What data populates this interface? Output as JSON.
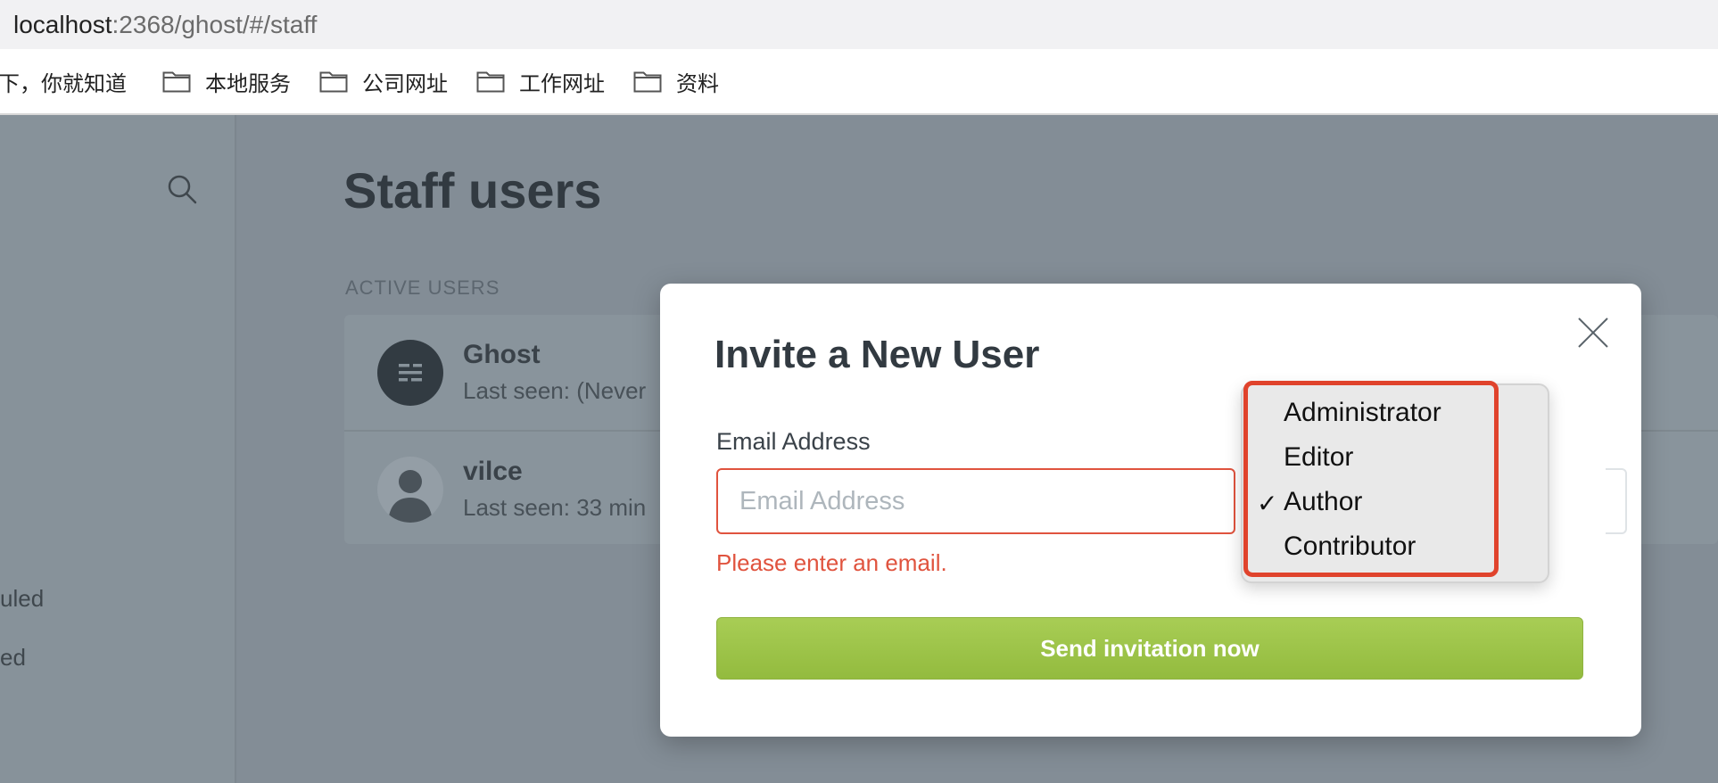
{
  "browser": {
    "url_host": "localhost",
    "url_rest": ":2368/ghost/#/staff",
    "bookmarks": [
      {
        "label": "下，你就知道",
        "icon": "none"
      },
      {
        "label": "本地服务",
        "icon": "folder-icon"
      },
      {
        "label": "公司网址",
        "icon": "folder-icon"
      },
      {
        "label": "工作网址",
        "icon": "folder-icon"
      },
      {
        "label": "资料",
        "icon": "folder-icon"
      }
    ]
  },
  "sidebar": {
    "search_icon": "search-icon",
    "items": [
      "uled",
      "ed"
    ]
  },
  "page": {
    "title": "Staff users",
    "section_label": "ACTIVE USERS",
    "users": [
      {
        "name": "Ghost",
        "last_seen": "Last seen: (Never"
      },
      {
        "name": "vilce",
        "last_seen": "Last seen: 33 min"
      }
    ]
  },
  "modal": {
    "title": "Invite a New User",
    "email_label": "Email Address",
    "email_placeholder": "Email Address",
    "email_value": "",
    "error": "Please enter an email.",
    "send_label": "Send invitation now",
    "role_options": [
      "Administrator",
      "Editor",
      "Author",
      "Contributor"
    ],
    "selected_role": "Author",
    "check_glyph": "✓"
  },
  "colors": {
    "error": "#e0533e",
    "send_button": "#9bc247",
    "highlight": "#e0432c",
    "overlay": "#838d96"
  }
}
